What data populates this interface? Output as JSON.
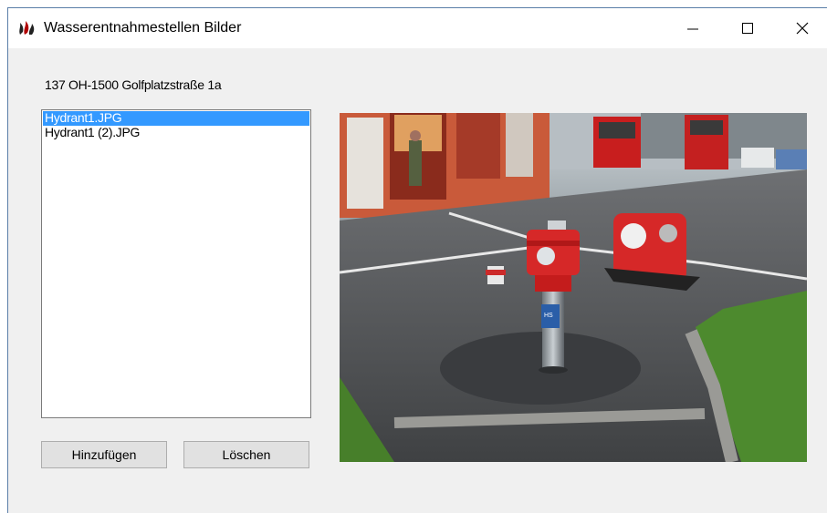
{
  "window": {
    "title": "Wasserentnahmestellen Bilder",
    "icon": "flame-app-icon",
    "controls": {
      "minimize": "minimize-icon",
      "maximize": "maximize-icon",
      "close": "close-icon"
    }
  },
  "record_label": "137 OH-1500 Golfplatzstraße 1a",
  "files": [
    {
      "name": "Hydrant1.JPG",
      "selected": true
    },
    {
      "name": "Hydrant1 (2).JPG",
      "selected": false
    }
  ],
  "buttons": {
    "add": "Hinzufügen",
    "delete": "Löschen"
  },
  "colors": {
    "selection": "#3399ff",
    "window_border": "#5a7fa8",
    "hydrant_red": "#d62828"
  }
}
